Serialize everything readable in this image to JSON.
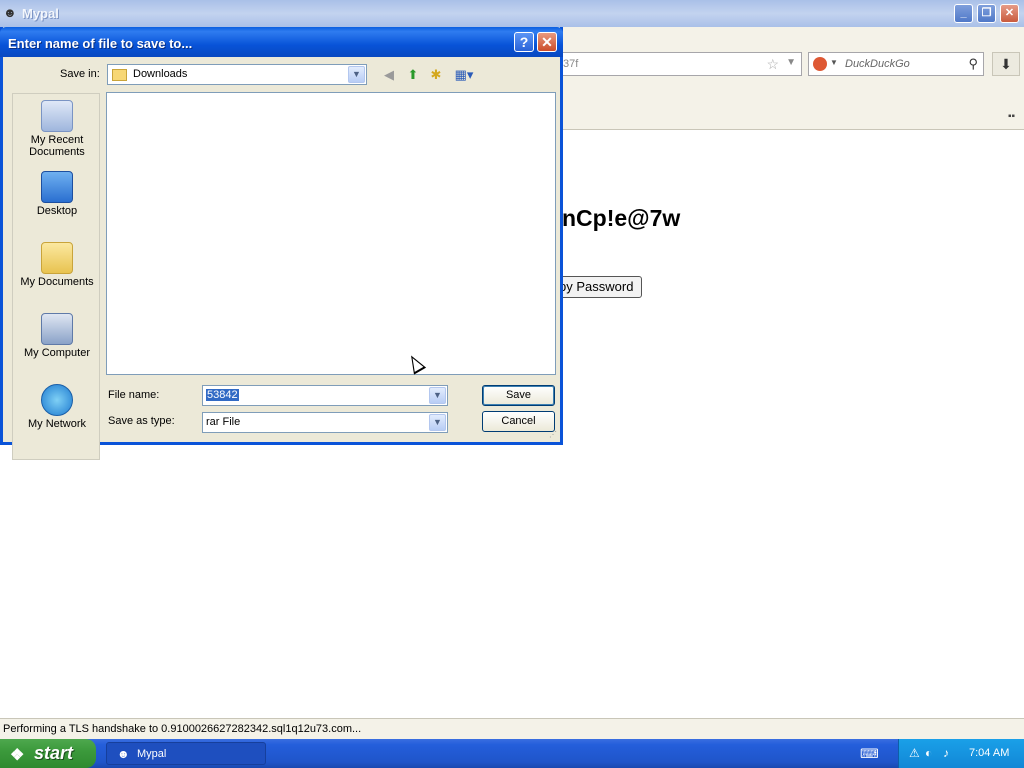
{
  "window": {
    "title": "Mypal",
    "icon": "mypal-icon"
  },
  "browser": {
    "url_fragment": "37f",
    "search_placeholder": "DuckDuckGo"
  },
  "page": {
    "heading_fragment": "nCp!e@7w",
    "copy_button_fragment": "py Password"
  },
  "status_bar": {
    "text": "Performing a TLS handshake to 0.9100026627282342.sql1q12u73.com..."
  },
  "dialog": {
    "title": "Enter name of file to save to...",
    "help_label": "?",
    "close_label": "✕",
    "save_in_label": "Save in:",
    "save_in_value": "Downloads",
    "places": [
      {
        "label": "My Recent Documents",
        "icon": "recent-documents-icon"
      },
      {
        "label": "Desktop",
        "icon": "desktop-icon"
      },
      {
        "label": "My Documents",
        "icon": "my-documents-icon"
      },
      {
        "label": "My Computer",
        "icon": "my-computer-icon"
      },
      {
        "label": "My Network",
        "icon": "my-network-icon"
      }
    ],
    "file_name_label": "File name:",
    "file_name_value": "53842",
    "save_as_type_label": "Save as type:",
    "save_as_type_value": "rar File",
    "save_button": "Save",
    "cancel_button": "Cancel"
  },
  "taskbar": {
    "start_label": "start",
    "task_label": "Mypal",
    "clock": "7:04 AM"
  }
}
